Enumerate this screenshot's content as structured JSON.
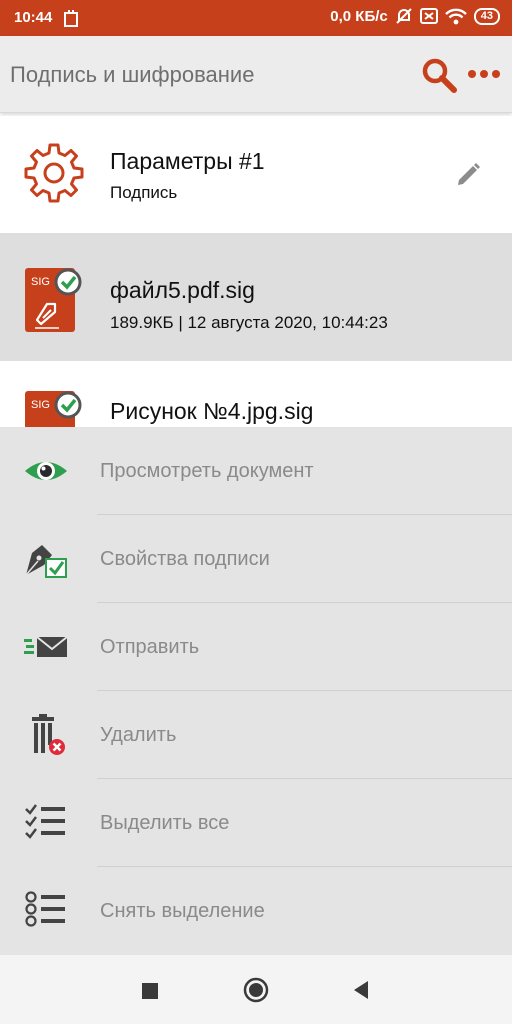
{
  "status_bar": {
    "time": "10:44",
    "speed": "0,0 КБ/с",
    "battery": "43"
  },
  "app_bar": {
    "title": "Подпись и шифрование"
  },
  "params_row": {
    "title": "Параметры #1",
    "subtitle": "Подпись"
  },
  "files": [
    {
      "name": "файл5.pdf.sig",
      "meta": "189.9КБ | 12 августа 2020, 10:44:23",
      "selected": true
    },
    {
      "name": "Рисунок №4.jpg.sig",
      "meta": "",
      "selected": false
    }
  ],
  "file_icon_text": "SIG",
  "menu": [
    {
      "label": "Просмотреть документ",
      "icon": "eye-icon"
    },
    {
      "label": "Свойства подписи",
      "icon": "signature-properties-icon"
    },
    {
      "label": "Отправить",
      "icon": "send-mail-icon"
    },
    {
      "label": "Удалить",
      "icon": "delete-icon"
    },
    {
      "label": "Выделить все",
      "icon": "select-all-icon"
    },
    {
      "label": "Снять выделение",
      "icon": "deselect-icon"
    }
  ],
  "colors": {
    "accent": "#c7401c",
    "green": "#2e9e4f",
    "selected_row": "#dedede",
    "sheet_bg": "#e4e4e4"
  }
}
